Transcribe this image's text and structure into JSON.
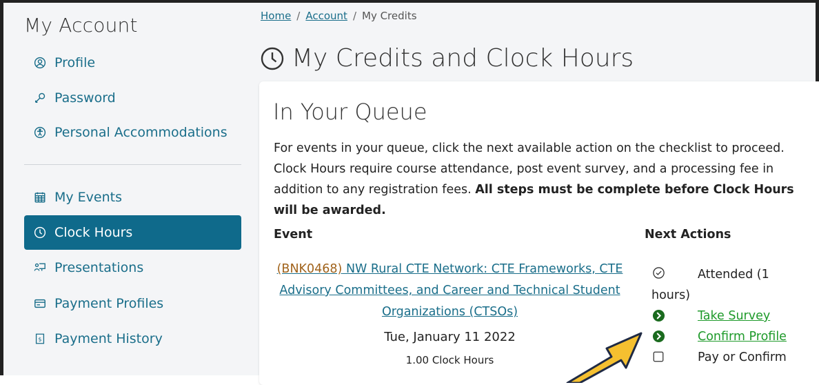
{
  "sidebar": {
    "title": "My Account",
    "items": [
      {
        "label": "Profile",
        "icon": "user-circle-icon"
      },
      {
        "label": "Password",
        "icon": "key-icon"
      },
      {
        "label": "Personal Accommodations",
        "icon": "accessibility-icon"
      },
      {
        "label": "My Events",
        "icon": "calendar-icon"
      },
      {
        "label": "Clock Hours",
        "icon": "clock-icon",
        "active": true
      },
      {
        "label": "Presentations",
        "icon": "presentation-icon"
      },
      {
        "label": "Payment Profiles",
        "icon": "credit-card-icon"
      },
      {
        "label": "Payment History",
        "icon": "receipt-icon"
      }
    ]
  },
  "breadcrumb": {
    "home": "Home",
    "account": "Account",
    "current": "My Credits",
    "separator": "/"
  },
  "page_title": "My Credits and Clock Hours",
  "queue": {
    "title": "In Your Queue",
    "intro_plain": "For events in your queue, click the next available action on the checklist to proceed. Clock Hours require course attendance, post event survey, and a processing fee in addition to any registration fees. ",
    "intro_bold": "All steps must be complete before Clock Hours will be awarded.",
    "col_event": "Event",
    "col_actions": "Next Actions"
  },
  "event": {
    "code": "(BNK0468)",
    "name": " NW Rural CTE Network: CTE Frameworks, CTE Advisory Committees, and Career and Technical Student Organizations (CTSOs)",
    "date": "Tue, January 11 2022",
    "hours": "1.00 Clock Hours"
  },
  "actions": {
    "attended": "Attended (1 hours)",
    "take_survey": "Take Survey",
    "confirm_profile": "Confirm Profile",
    "pay_or_confirm": "Pay or Confirm"
  },
  "colors": {
    "accent": "#0f6a8b",
    "link": "#1a6e8a",
    "action_link": "#1e9a2a",
    "action_icon": "#1b6b1f",
    "arrow": "#f5c030"
  }
}
